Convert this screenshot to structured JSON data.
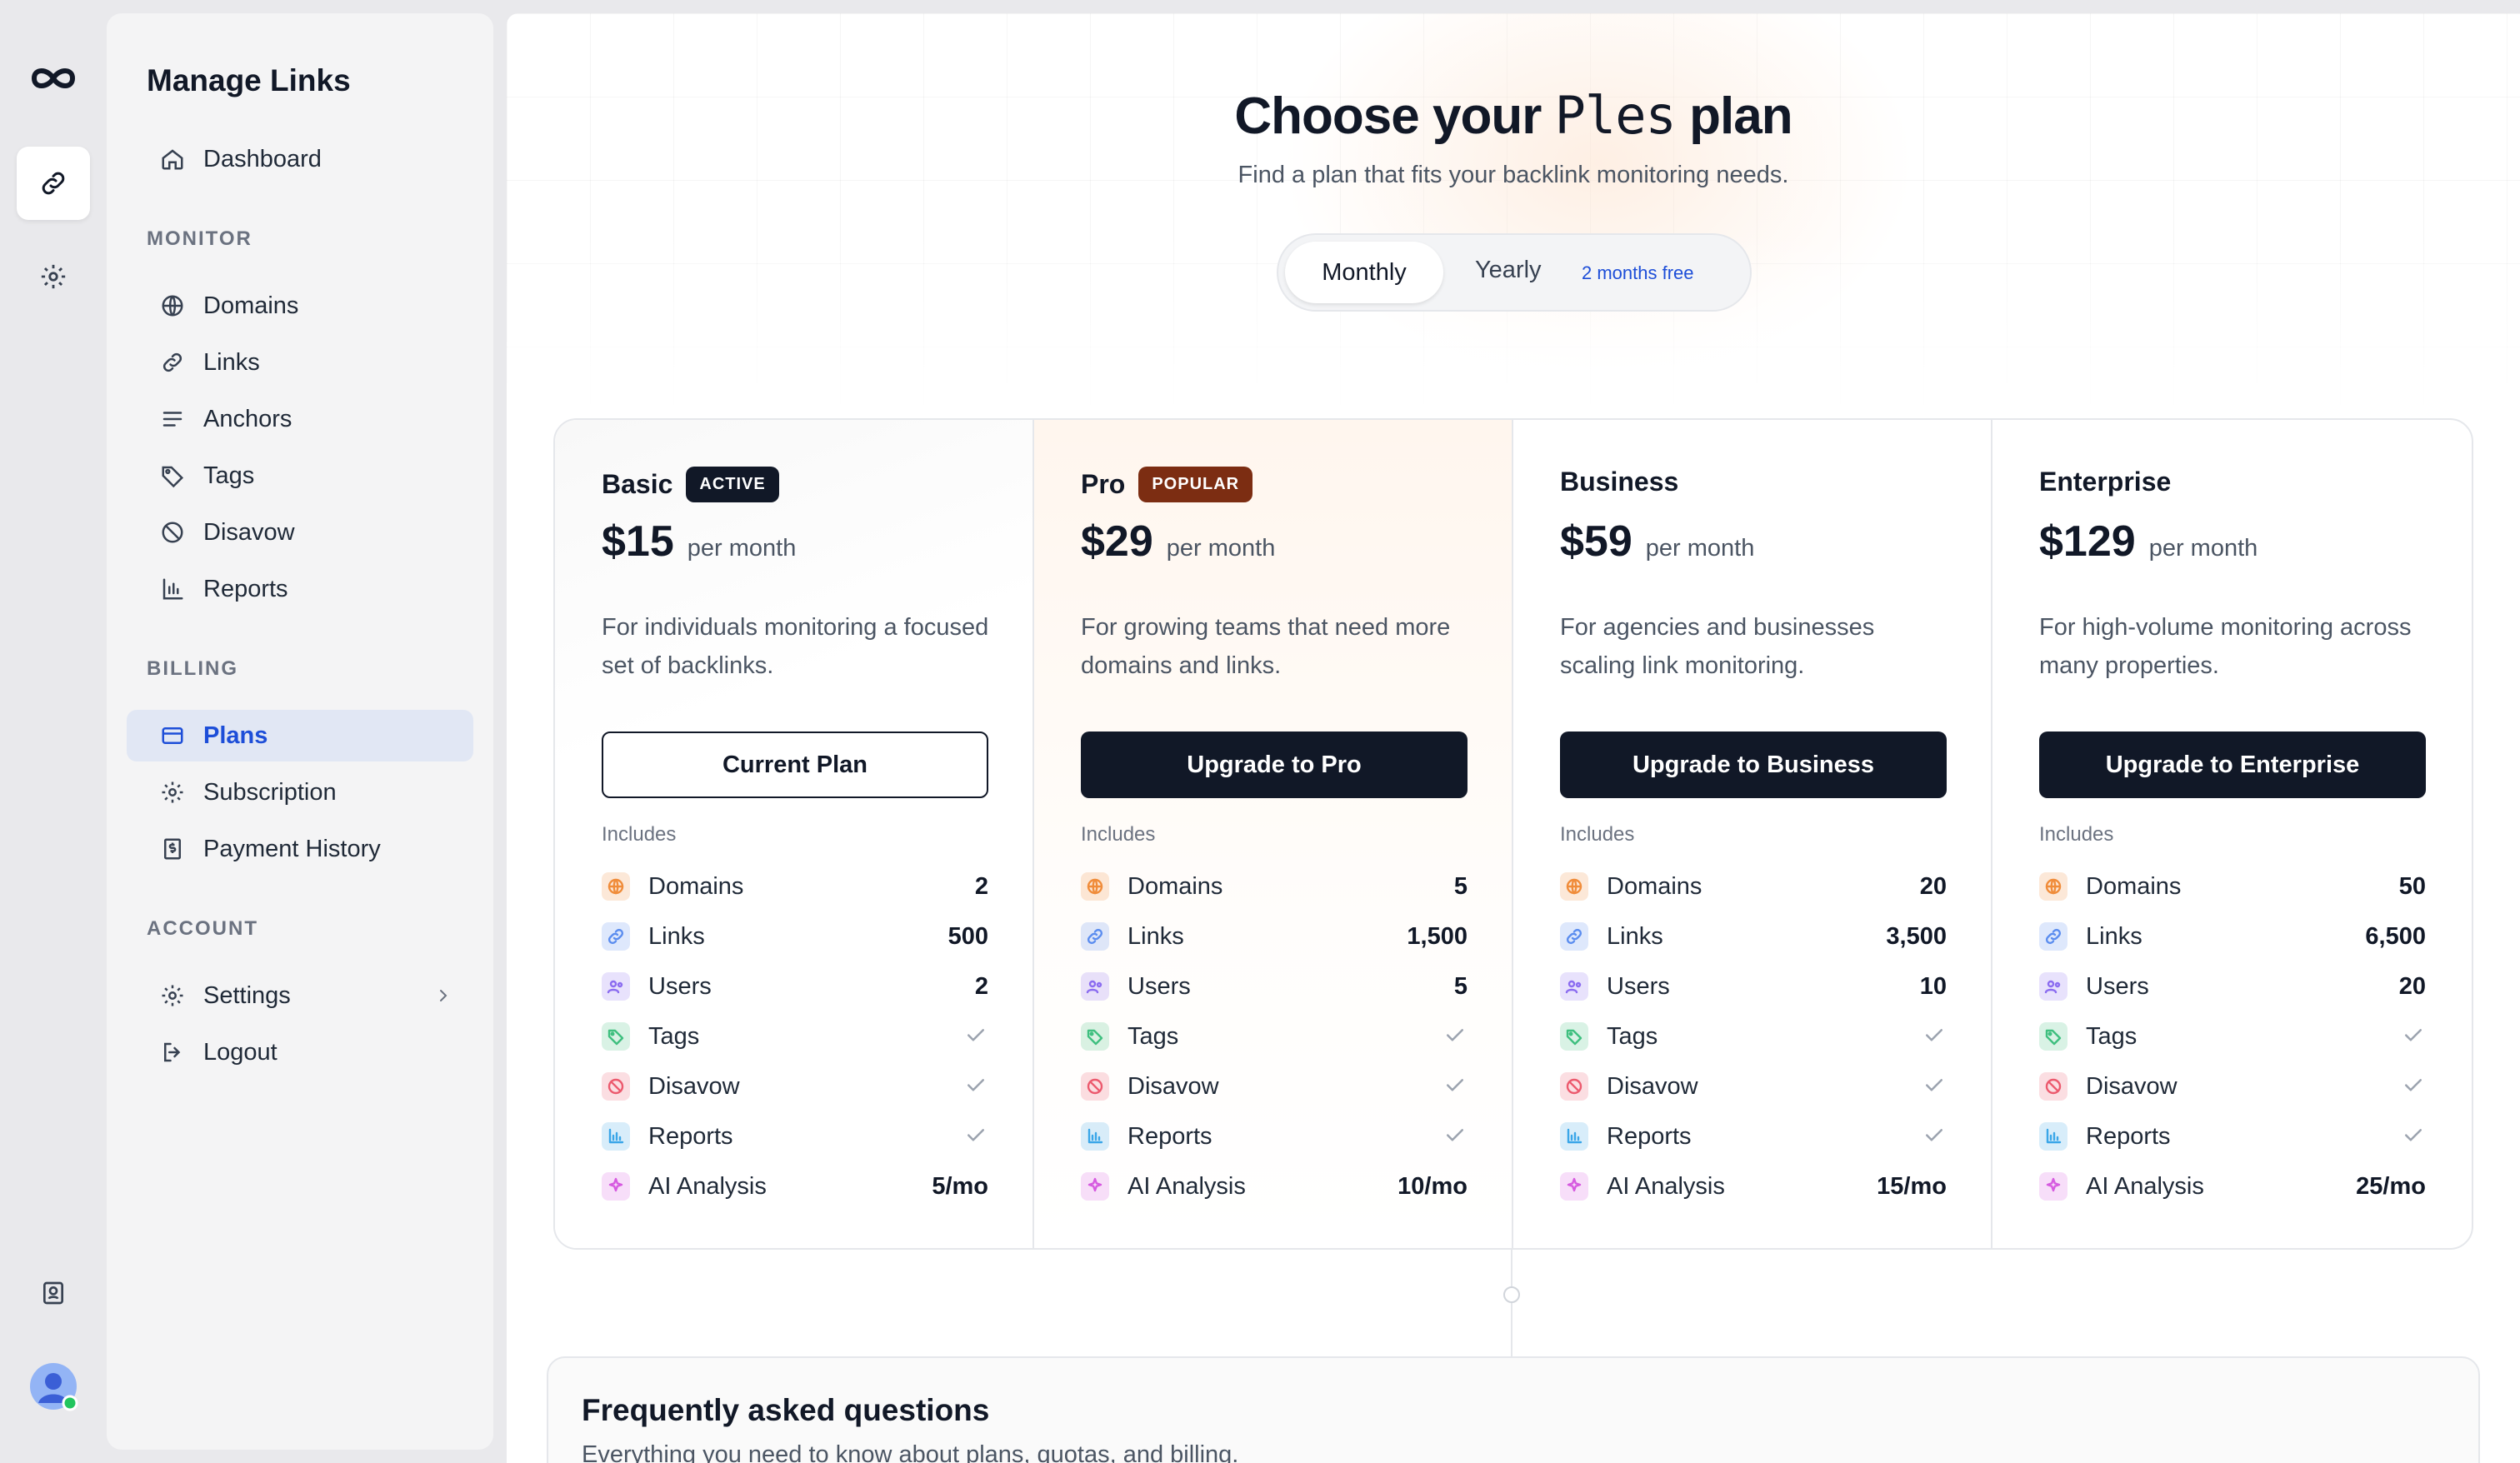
{
  "sidebar": {
    "title": "Manage Links",
    "dashboard": "Dashboard",
    "monitor_label": "MONITOR",
    "monitor_items": [
      "Domains",
      "Links",
      "Anchors",
      "Tags",
      "Disavow",
      "Reports"
    ],
    "billing_label": "BILLING",
    "billing_items": [
      "Plans",
      "Subscription",
      "Payment History"
    ],
    "account_label": "ACCOUNT",
    "account_items": [
      "Settings",
      "Logout"
    ],
    "active_item": "Plans"
  },
  "hero": {
    "title_prefix": "Choose your",
    "title_brand": "Ples",
    "title_suffix": "plan",
    "subtitle": "Find a plan that fits your backlink monitoring needs."
  },
  "billing_toggle": {
    "monthly": "Monthly",
    "yearly": "Yearly",
    "yearly_badge": "2 months free",
    "selected": "Monthly"
  },
  "plans": [
    {
      "name": "Basic",
      "badge": "ACTIVE",
      "price": "$15",
      "period": "per month",
      "description": "For individuals monitoring a focused set of backlinks.",
      "button": "Current Plan",
      "includes": "Includes",
      "features": [
        "2",
        "500",
        "2",
        "✓",
        "✓",
        "✓",
        "5/mo"
      ]
    },
    {
      "name": "Pro",
      "badge": "POPULAR",
      "price": "$29",
      "period": "per month",
      "description": "For growing teams that need more domains and links.",
      "button": "Upgrade to Pro",
      "includes": "Includes",
      "features": [
        "5",
        "1,500",
        "5",
        "✓",
        "✓",
        "✓",
        "10/mo"
      ]
    },
    {
      "name": "Business",
      "badge": "",
      "price": "$59",
      "period": "per month",
      "description": "For agencies and businesses scaling link monitoring.",
      "button": "Upgrade to Business",
      "includes": "Includes",
      "features": [
        "20",
        "3,500",
        "10",
        "✓",
        "✓",
        "✓",
        "15/mo"
      ]
    },
    {
      "name": "Enterprise",
      "badge": "",
      "price": "$129",
      "period": "per month",
      "description": "For high-volume monitoring across many properties.",
      "button": "Upgrade to Enterprise",
      "includes": "Includes",
      "features": [
        "50",
        "6,500",
        "20",
        "✓",
        "✓",
        "✓",
        "25/mo"
      ]
    }
  ],
  "feature_names": [
    "Domains",
    "Links",
    "Users",
    "Tags",
    "Disavow",
    "Reports",
    "AI Analysis"
  ],
  "feature_colors": [
    "#f08c3a",
    "#5b8def",
    "#8b6cf0",
    "#3fbf7f",
    "#ec5a6e",
    "#3aa6e8",
    "#d65ae0"
  ],
  "faq": {
    "title": "Frequently asked questions",
    "subtitle": "Everything you need to know about plans, quotas, and billing."
  }
}
